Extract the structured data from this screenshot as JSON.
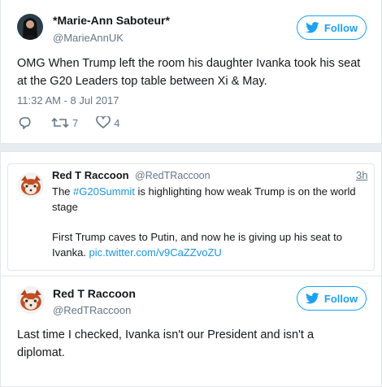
{
  "tweet1": {
    "author_name": "*Marie-Ann Saboteur*",
    "author_handle": "@MarieAnnUK",
    "follow_label": "Follow",
    "text": "OMG When Trump left the room his daughter Ivanka took his seat at the G20 Leaders top table between Xi & May.",
    "timestamp": "11:32 AM - 8 Jul 2017",
    "retweet_count": "7",
    "like_count": "4"
  },
  "quoted": {
    "author_name": "Red T Raccoon",
    "author_handle": "@RedTRaccoon",
    "time": "3h",
    "text_pre": "The ",
    "hashtag": "#G20Summit",
    "text_post": " is highlighting how weak Trump is on the world stage",
    "text2": "First Trump caves to Putin, and now he is giving up his seat to Ivanka. ",
    "link": "pic.twitter.com/v9CaZZvoZU"
  },
  "tweet2": {
    "author_name": "Red T Raccoon",
    "author_handle": "@RedTRaccoon",
    "follow_label": "Follow",
    "text": "Last time I checked, Ivanka isn't our President and isn't a diplomat."
  },
  "colors": {
    "accent": "#1da1f2",
    "link": "#1b95e0",
    "muted": "#657786",
    "background": "#e6ecf0"
  },
  "icons": [
    "reply-icon",
    "retweet-icon",
    "like-icon",
    "twitter-bird-icon"
  ]
}
